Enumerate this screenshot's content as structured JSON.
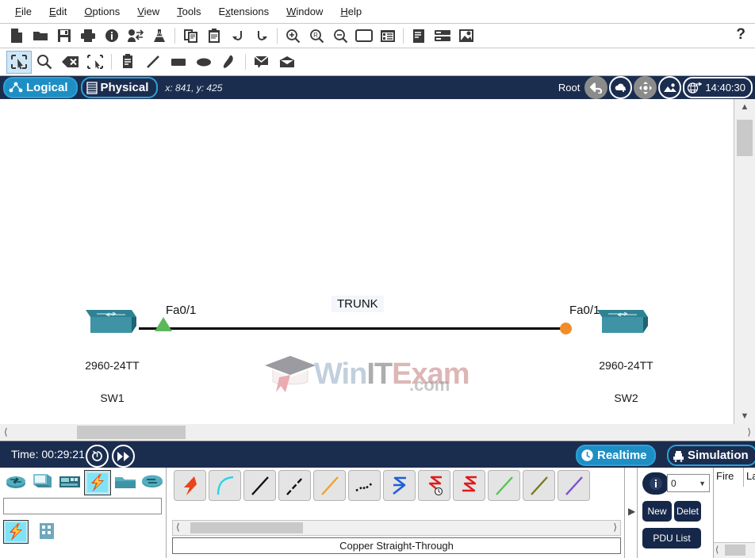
{
  "menu": {
    "items": [
      {
        "label": "File",
        "mnemonic": "F"
      },
      {
        "label": "Edit",
        "mnemonic": "E"
      },
      {
        "label": "Options",
        "mnemonic": "O"
      },
      {
        "label": "View",
        "mnemonic": "V"
      },
      {
        "label": "Tools",
        "mnemonic": "T"
      },
      {
        "label": "Extensions",
        "mnemonic": "x"
      },
      {
        "label": "Window",
        "mnemonic": "W"
      },
      {
        "label": "Help",
        "mnemonic": "H"
      }
    ]
  },
  "toolbar_main": {
    "help_label": "?",
    "items": [
      {
        "icon": "new-file-icon",
        "name": "new-button"
      },
      {
        "icon": "open-folder-icon",
        "name": "open-button"
      },
      {
        "icon": "save-disk-icon",
        "name": "save-button"
      },
      {
        "icon": "printer-icon",
        "name": "print-button"
      },
      {
        "icon": "info-icon",
        "name": "network-info-button"
      },
      {
        "icon": "activity-wizard-icon",
        "name": "activity-wizard-button"
      },
      {
        "icon": "multiuser-icon",
        "name": "multiuser-button"
      },
      {
        "icon": "copy-icon",
        "name": "copy-button"
      },
      {
        "icon": "paste-icon",
        "name": "paste-button"
      },
      {
        "icon": "undo-arrow-icon",
        "name": "undo-button"
      },
      {
        "icon": "redo-arrow-icon",
        "name": "redo-button"
      },
      {
        "icon": "zoom-in-icon",
        "name": "zoom-in-button"
      },
      {
        "icon": "zoom-reset-icon",
        "name": "zoom-reset-button"
      },
      {
        "icon": "zoom-out-icon",
        "name": "zoom-out-button"
      },
      {
        "icon": "palette-window-icon",
        "name": "palette-button"
      },
      {
        "icon": "custom-devices-icon",
        "name": "custom-devices-button"
      },
      {
        "icon": "notes-panel-icon",
        "name": "notes-panel-button"
      },
      {
        "icon": "rack-view-icon",
        "name": "rack-view-button"
      },
      {
        "icon": "backdrop-image-icon",
        "name": "backdrop-button"
      }
    ]
  },
  "toolbar_tools": {
    "items": [
      {
        "icon": "select-arrow-icon",
        "name": "select-tool",
        "selected": true
      },
      {
        "icon": "magnifier-icon",
        "name": "inspect-tool",
        "selected": false
      },
      {
        "icon": "delete-x-icon",
        "name": "delete-tool",
        "selected": false
      },
      {
        "icon": "resize-shape-icon",
        "name": "resize-shape-tool",
        "selected": false
      },
      {
        "icon": "note-icon",
        "name": "place-note-tool",
        "selected": false
      },
      {
        "icon": "line-icon",
        "name": "draw-line-tool",
        "selected": false
      },
      {
        "icon": "rectangle-icon",
        "name": "draw-rectangle-tool",
        "selected": false
      },
      {
        "icon": "ellipse-icon",
        "name": "draw-ellipse-tool",
        "selected": false
      },
      {
        "icon": "freeform-icon",
        "name": "draw-freeform-tool",
        "selected": false
      },
      {
        "icon": "simple-pdu-envelope-icon",
        "name": "add-simple-pdu-tool",
        "selected": false
      },
      {
        "icon": "complex-pdu-envelope-icon",
        "name": "add-complex-pdu-tool",
        "selected": false
      }
    ]
  },
  "viewbar": {
    "logical_label": "Logical",
    "physical_label": "Physical",
    "active_view": "Logical",
    "coords": "x: 841, y: 425",
    "root_label": "Root",
    "clock": "14:40:30",
    "buttons": [
      {
        "name": "back-button",
        "icon": "back-arrow-icon"
      },
      {
        "name": "new-cluster-button",
        "icon": "cloud-plus-icon"
      },
      {
        "name": "move-object-button",
        "icon": "move-arrows-icon"
      },
      {
        "name": "set-tiled-background-button",
        "icon": "landscape-image-icon"
      }
    ]
  },
  "canvas": {
    "trunk_label": "TRUNK",
    "devices": [
      {
        "name": "SW1",
        "model": "2960-24TT",
        "port": "Fa0/1",
        "link_status": "forwarding",
        "link_status_color": "#5cb85c"
      },
      {
        "name": "SW2",
        "model": "2960-24TT",
        "port": "Fa0/1",
        "link_status": "blocking",
        "link_status_color": "#f28c28"
      }
    ],
    "watermark": {
      "part1": "Win",
      "part2": "IT",
      "part3": "Exam",
      "suffix": ".com"
    }
  },
  "timebar": {
    "time_label": "Time:",
    "time_value": "00:29:21",
    "power_cycle_name": "power-cycle-devices-button",
    "fast_forward_name": "fast-forward-time-button",
    "realtime_label": "Realtime",
    "simulation_label": "Simulation",
    "active_mode": "Realtime"
  },
  "device_panel": {
    "categories": [
      {
        "label": "Network Devices",
        "icon": "router-icon",
        "selected": false
      },
      {
        "label": "End Devices",
        "icon": "pc-icon",
        "selected": false
      },
      {
        "label": "Components",
        "icon": "board-icon",
        "selected": false
      },
      {
        "label": "Connections",
        "icon": "lightning-icon",
        "selected": true
      },
      {
        "label": "Miscellaneous",
        "icon": "folder-icon",
        "selected": false
      },
      {
        "label": "Multiuser Connection",
        "icon": "cloud-icon",
        "selected": false
      }
    ],
    "search_value": "",
    "search_placeholder": "",
    "subcategories": [
      {
        "label": "Connections",
        "icon": "lightning-icon",
        "selected": true
      },
      {
        "label": "Grid",
        "icon": "grid-icon",
        "selected": false
      }
    ]
  },
  "connections": {
    "status_text": "Copper Straight-Through",
    "items": [
      {
        "label": "Automatic",
        "icon": "auto-lightning-icon",
        "color": "#e8521f"
      },
      {
        "label": "Console",
        "icon": "console-curve-icon",
        "color": "#2ad3e8"
      },
      {
        "label": "Copper Straight-Through",
        "icon": "straight-line-icon",
        "color": "#111111"
      },
      {
        "label": "Copper Cross-Over",
        "icon": "dashed-line-icon",
        "color": "#111111"
      },
      {
        "label": "Fiber",
        "icon": "fiber-line-icon",
        "color": "#f0a030"
      },
      {
        "label": "Phone",
        "icon": "phone-dotted-icon",
        "color": "#111111"
      },
      {
        "label": "Coaxial",
        "icon": "coax-zigzag-icon",
        "color": "#1f5fd8"
      },
      {
        "label": "Serial DCE",
        "icon": "serial-dce-icon",
        "color": "#e01b1b"
      },
      {
        "label": "Serial DTE",
        "icon": "serial-dte-icon",
        "color": "#e01b1b"
      },
      {
        "label": "Octal",
        "icon": "octal-line-icon",
        "color": "#56c456"
      },
      {
        "label": "IoT Custom Cable",
        "icon": "iot-line-icon",
        "color": "#7a7a20"
      },
      {
        "label": "Custom",
        "icon": "custom-line-icon",
        "color": "#7b4fd0"
      }
    ]
  },
  "pdu_panel": {
    "info_icon": "info-icon",
    "scenario_value": "0",
    "new_label": "New",
    "delete_label": "Delet",
    "pdu_list_label": "PDU List",
    "columns": [
      "Fire",
      "Las"
    ]
  }
}
